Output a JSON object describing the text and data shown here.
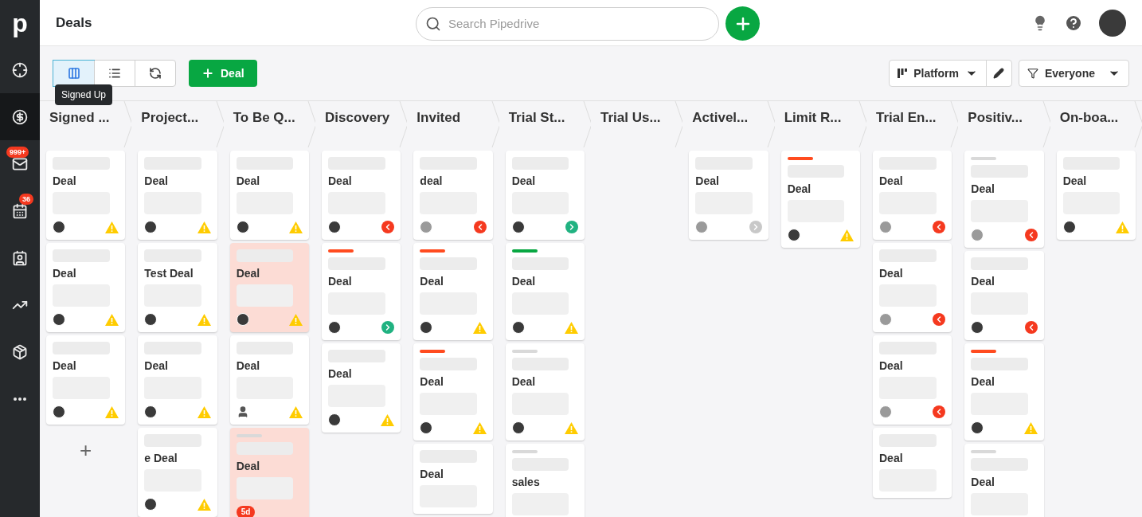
{
  "sidebar": {
    "logo": "p",
    "items": [
      {
        "selected": false
      },
      {
        "selected": true
      },
      {
        "selected": false,
        "badge": "999+"
      },
      {
        "selected": false,
        "badge": "36"
      },
      {
        "selected": false
      },
      {
        "selected": false
      },
      {
        "selected": false
      },
      {
        "selected": false
      }
    ]
  },
  "header": {
    "title": "Deals",
    "search": {
      "placeholder": "Search Pipedrive"
    }
  },
  "toolbar": {
    "views": [
      {
        "selected": true
      },
      {
        "selected": false
      },
      {
        "selected": false
      }
    ],
    "tooltip": "Signed Up",
    "add_button": "Deal",
    "pipeline": "Platform",
    "filter": "Everyone"
  },
  "columns": [
    {
      "title": "Signed ...",
      "add_label": "+",
      "cards": [
        {
          "title": "Deal",
          "avatar": {
            "kind": "photo"
          },
          "status": {
            "kind": "warning"
          },
          "rotten": false
        },
        {
          "title": "Deal",
          "avatar": {
            "kind": "photo"
          },
          "status": {
            "kind": "warning"
          },
          "rotten": false
        },
        {
          "title": "Deal",
          "avatar": {
            "kind": "photo"
          },
          "status": {
            "kind": "warning"
          },
          "rotten": false
        }
      ]
    },
    {
      "title": "Project...",
      "cards": [
        {
          "title": "Deal",
          "avatar": {
            "kind": "photo"
          },
          "status": {
            "kind": "warning"
          },
          "rotten": false
        },
        {
          "title": "Test Deal",
          "avatar": {
            "kind": "photo"
          },
          "status": {
            "kind": "warning"
          },
          "rotten": false
        },
        {
          "title": "Deal",
          "avatar": {
            "kind": "photo"
          },
          "status": {
            "kind": "warning"
          },
          "rotten": false
        },
        {
          "title": "e Deal",
          "avatar": {
            "kind": "photo"
          },
          "status": {
            "kind": "warning"
          },
          "rotten": false
        }
      ]
    },
    {
      "title": "To Be Q...",
      "cards": [
        {
          "title": "Deal",
          "avatar": {
            "kind": "photo"
          },
          "status": {
            "kind": "warning"
          },
          "rotten": false
        },
        {
          "title": "Deal",
          "avatar": {
            "kind": "photo"
          },
          "status": {
            "kind": "warning"
          },
          "rotten": true
        },
        {
          "title": "Deal",
          "avatar": {
            "kind": "person"
          },
          "status": {
            "kind": "warning"
          },
          "rotten": false
        },
        {
          "title": "Deal",
          "color": "#d9d9d9",
          "badge": "5d",
          "rotten": true
        }
      ]
    },
    {
      "title": "Discovery",
      "cards": [
        {
          "title": "Deal",
          "avatar": {
            "kind": "photo"
          },
          "status": {
            "kind": "overdue"
          },
          "rotten": false
        },
        {
          "title": "Deal",
          "color": "#ff4b1f",
          "avatar": {
            "kind": "photo"
          },
          "status": {
            "kind": "next"
          },
          "rotten": false
        },
        {
          "title": "Deal",
          "avatar": {
            "kind": "photo"
          },
          "status": {
            "kind": "warning"
          },
          "rotten": false
        }
      ]
    },
    {
      "title": "Invited",
      "cards": [
        {
          "title": "deal",
          "avatar": {
            "kind": "gray"
          },
          "status": {
            "kind": "overdue"
          },
          "rotten": false
        },
        {
          "title": "Deal",
          "color": "#ff4b1f",
          "avatar": {
            "kind": "photo"
          },
          "status": {
            "kind": "warning"
          },
          "rotten": false
        },
        {
          "title": "Deal",
          "color": "#ff4b1f",
          "avatar": {
            "kind": "photo"
          },
          "status": {
            "kind": "warning"
          },
          "rotten": false
        },
        {
          "title": "Deal",
          "rotten": false
        }
      ]
    },
    {
      "title": "Trial St...",
      "cards": [
        {
          "title": "Deal",
          "avatar": {
            "kind": "photo"
          },
          "status": {
            "kind": "next"
          },
          "rotten": false
        },
        {
          "title": "Deal",
          "color": "#08a742",
          "avatar": {
            "kind": "photo"
          },
          "status": {
            "kind": "warning"
          },
          "rotten": false
        },
        {
          "title": "Deal",
          "color": "#d9d9d9",
          "avatar": {
            "kind": "photo"
          },
          "status": {
            "kind": "warning"
          },
          "rotten": false
        },
        {
          "title": "sales",
          "color": "#d9d9d9",
          "rotten": false
        }
      ]
    },
    {
      "title": "Trial Us..."
    },
    {
      "title": "Activel...",
      "cards": [
        {
          "title": "Deal",
          "avatar": {
            "kind": "gray"
          },
          "status": {
            "kind": "idle"
          },
          "rotten": false
        }
      ]
    },
    {
      "title": "Limit R...",
      "cards": [
        {
          "title": "Deal",
          "color": "#ff4b1f",
          "avatar": {
            "kind": "photo"
          },
          "status": {
            "kind": "warning"
          },
          "rotten": false
        }
      ]
    },
    {
      "title": "Trial En...",
      "cards": [
        {
          "title": "Deal",
          "avatar": {
            "kind": "gray"
          },
          "status": {
            "kind": "overdue"
          },
          "rotten": false
        },
        {
          "title": "Deal",
          "avatar": {
            "kind": "gray"
          },
          "status": {
            "kind": "overdue"
          },
          "rotten": false
        },
        {
          "title": "Deal",
          "avatar": {
            "kind": "gray"
          },
          "status": {
            "kind": "overdue"
          },
          "rotten": false
        },
        {
          "title": "Deal",
          "rotten": false
        }
      ]
    },
    {
      "title": "Positiv...",
      "cards": [
        {
          "title": "Deal",
          "color": "#d9d9d9",
          "avatar": {
            "kind": "gray"
          },
          "status": {
            "kind": "overdue"
          },
          "rotten": false
        },
        {
          "title": "Deal",
          "avatar": {
            "kind": "photo"
          },
          "status": {
            "kind": "overdue"
          },
          "rotten": false
        },
        {
          "title": "Deal",
          "color": "#ff4b1f",
          "avatar": {
            "kind": "photo"
          },
          "status": {
            "kind": "warning"
          },
          "rotten": false
        },
        {
          "title": "Deal",
          "color": "#d9d9d9",
          "rotten": false
        }
      ]
    },
    {
      "title": "On-boa...",
      "cards": [
        {
          "title": "Deal",
          "avatar": {
            "kind": "photo"
          },
          "status": {
            "kind": "warning"
          },
          "rotten": false
        }
      ]
    }
  ]
}
